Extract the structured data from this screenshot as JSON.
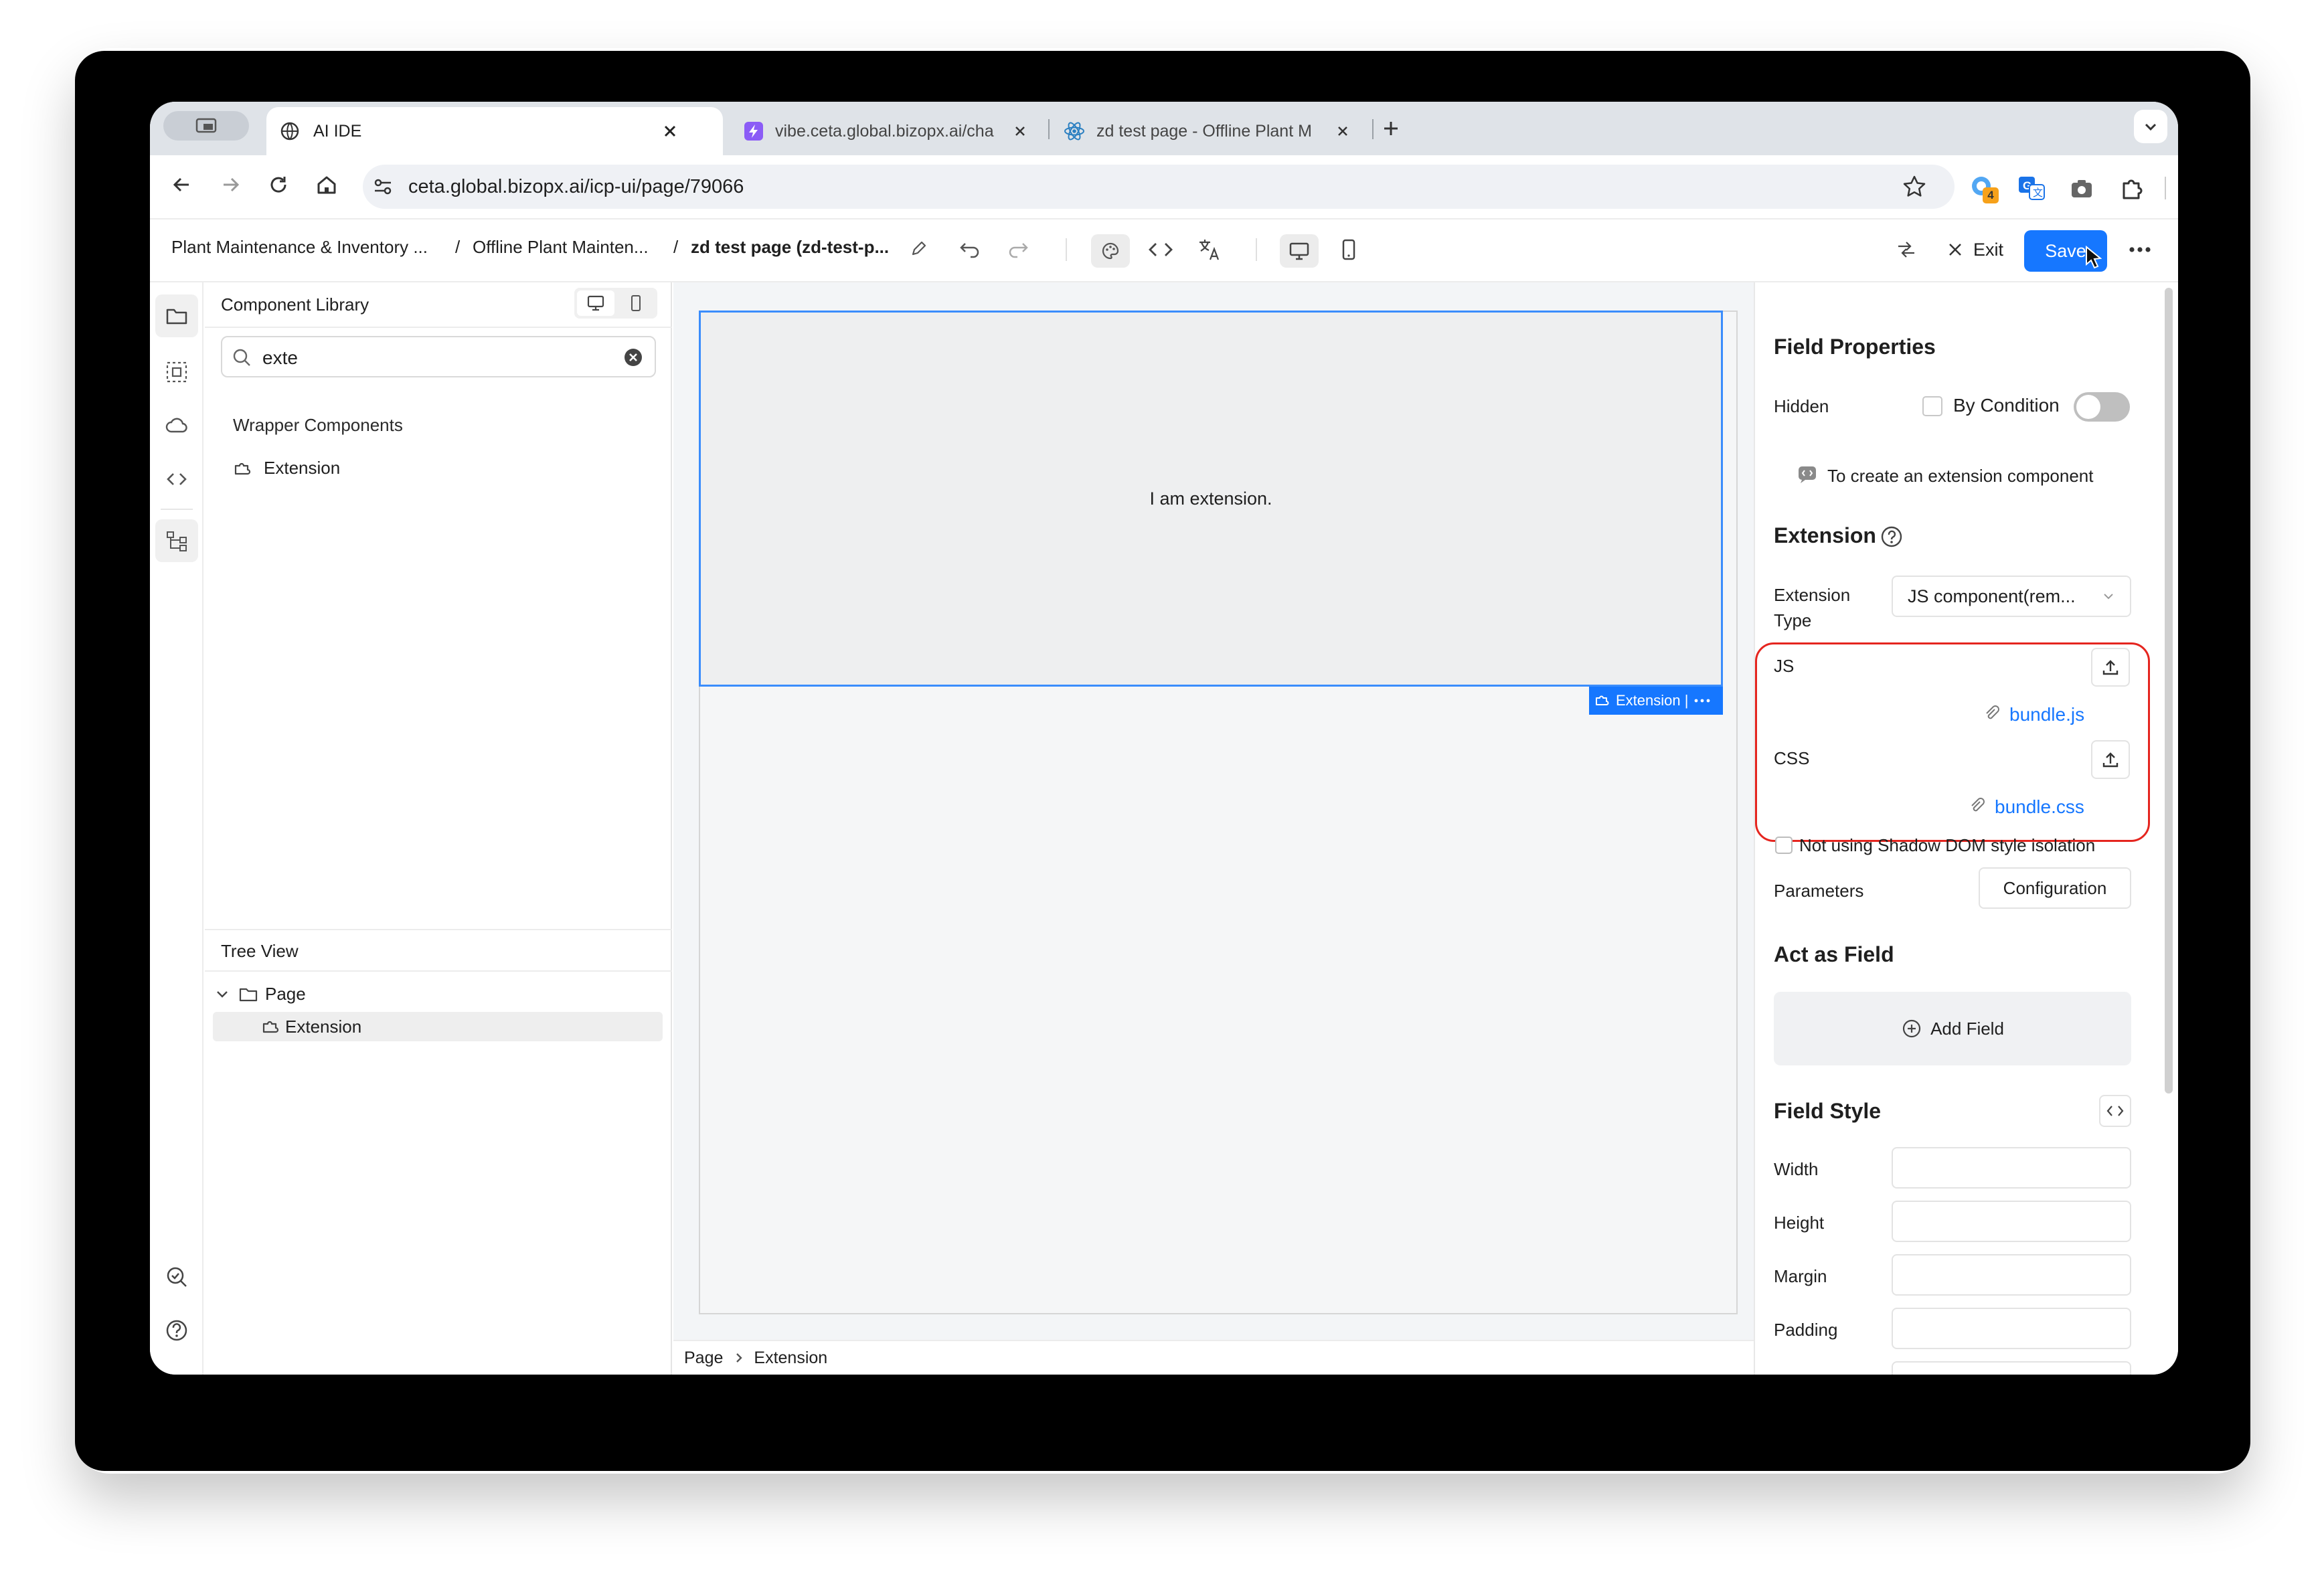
{
  "browser": {
    "tabs": [
      {
        "label": "AI IDE"
      },
      {
        "label": "vibe.ceta.global.bizopx.ai/cha"
      },
      {
        "label": "zd test page - Offline Plant M"
      }
    ],
    "url": "ceta.global.bizopx.ai/icp-ui/page/79066",
    "extension_badge": "4"
  },
  "app": {
    "breadcrumb": [
      "Plant Maintenance & Inventory ...",
      "Offline Plant Mainten...",
      "zd test page (zd-test-p..."
    ],
    "breadcrumb_sep": "/",
    "exit_label": "Exit",
    "save_label": "Save"
  },
  "left_panel": {
    "title": "Component Library",
    "search_value": "exte",
    "group_title": "Wrapper Components",
    "component_item": "Extension",
    "tree_title": "Tree View",
    "tree_root": "Page",
    "tree_child": "Extension"
  },
  "canvas": {
    "extension_text": "I am extension.",
    "selection_label": "Extension |",
    "status_crumbs": [
      "Page",
      "Extension"
    ]
  },
  "properties": {
    "title": "Field Properties",
    "hidden_label": "Hidden",
    "by_condition_label": "By Condition",
    "hint": "To create an extension component",
    "extension_section": "Extension",
    "ext_type_label_line1": "Extension",
    "ext_type_label_line2": "Type",
    "ext_type_value": "JS component(rem...",
    "js_label": "JS",
    "js_file": "bundle.js",
    "css_label": "CSS",
    "css_file": "bundle.css",
    "shadow_dom_label": "Not using Shadow DOM style isolation",
    "parameters_label": "Parameters",
    "configuration_button": "Configuration",
    "act_as_field_title": "Act as Field",
    "add_field_label": "Add Field",
    "field_style_title": "Field Style",
    "style_fields": [
      "Width",
      "Height",
      "Margin",
      "Padding"
    ]
  },
  "colors": {
    "accent": "#1677ff",
    "highlight_border": "#e5251f"
  }
}
